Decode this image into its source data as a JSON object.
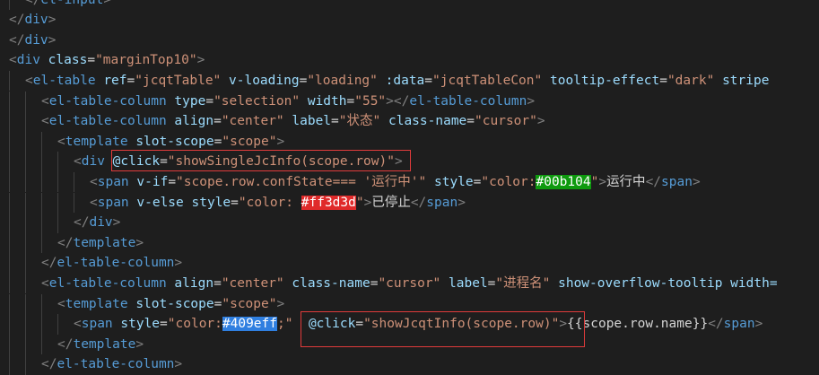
{
  "editor": {
    "colors": {
      "background": "#1e1e1e",
      "tag": "#569cd6",
      "attribute": "#9cdcfe",
      "string": "#ce9178",
      "punctuation": "#808080",
      "text": "#d4d4d4",
      "annotation_box": "#e03b3b"
    },
    "lines": [
      {
        "tokens": [
          {
            "c": "punct",
            "v": "</"
          },
          {
            "c": "tag",
            "v": "el-input"
          },
          {
            "c": "punct",
            "v": ">"
          }
        ]
      },
      {
        "tokens": [
          {
            "c": "punct",
            "v": "</"
          },
          {
            "c": "tag",
            "v": "div"
          },
          {
            "c": "punct",
            "v": ">"
          }
        ]
      },
      {
        "tokens": [
          {
            "c": "punct",
            "v": "</"
          },
          {
            "c": "tag",
            "v": "div"
          },
          {
            "c": "punct",
            "v": ">"
          }
        ]
      },
      {
        "tokens": [
          {
            "c": "punct",
            "v": "<"
          },
          {
            "c": "tag",
            "v": "div"
          },
          {
            "c": "text",
            "v": " "
          },
          {
            "c": "attr",
            "v": "class"
          },
          {
            "c": "op",
            "v": "="
          },
          {
            "c": "str",
            "v": "\"marginTop10\""
          },
          {
            "c": "punct",
            "v": ">"
          }
        ]
      },
      {
        "tokens": [
          {
            "c": "punct",
            "v": "<"
          },
          {
            "c": "tag",
            "v": "el-table"
          },
          {
            "c": "text",
            "v": " "
          },
          {
            "c": "attr",
            "v": "ref"
          },
          {
            "c": "op",
            "v": "="
          },
          {
            "c": "str",
            "v": "\"jcqtTable\""
          },
          {
            "c": "text",
            "v": " "
          },
          {
            "c": "attr",
            "v": "v-loading"
          },
          {
            "c": "op",
            "v": "="
          },
          {
            "c": "str",
            "v": "\"loading\""
          },
          {
            "c": "text",
            "v": " "
          },
          {
            "c": "attr",
            "v": ":data"
          },
          {
            "c": "op",
            "v": "="
          },
          {
            "c": "str",
            "v": "\"jcqtTableCon\""
          },
          {
            "c": "text",
            "v": " "
          },
          {
            "c": "attr",
            "v": "tooltip-effect"
          },
          {
            "c": "op",
            "v": "="
          },
          {
            "c": "str",
            "v": "\"dark\""
          },
          {
            "c": "text",
            "v": " "
          },
          {
            "c": "attr",
            "v": "stripe"
          }
        ]
      },
      {
        "tokens": [
          {
            "c": "punct",
            "v": "<"
          },
          {
            "c": "tag",
            "v": "el-table-column"
          },
          {
            "c": "text",
            "v": " "
          },
          {
            "c": "attr",
            "v": "type"
          },
          {
            "c": "op",
            "v": "="
          },
          {
            "c": "str",
            "v": "\"selection\""
          },
          {
            "c": "text",
            "v": " "
          },
          {
            "c": "attr",
            "v": "width"
          },
          {
            "c": "op",
            "v": "="
          },
          {
            "c": "str",
            "v": "\"55\""
          },
          {
            "c": "punct",
            "v": "></"
          },
          {
            "c": "tag",
            "v": "el-table-column"
          },
          {
            "c": "punct",
            "v": ">"
          }
        ]
      },
      {
        "tokens": [
          {
            "c": "punct",
            "v": "<"
          },
          {
            "c": "tag",
            "v": "el-table-column"
          },
          {
            "c": "text",
            "v": " "
          },
          {
            "c": "attr",
            "v": "align"
          },
          {
            "c": "op",
            "v": "="
          },
          {
            "c": "str",
            "v": "\"center\""
          },
          {
            "c": "text",
            "v": " "
          },
          {
            "c": "attr",
            "v": "label"
          },
          {
            "c": "op",
            "v": "="
          },
          {
            "c": "str",
            "v": "\"状态\""
          },
          {
            "c": "text",
            "v": " "
          },
          {
            "c": "attr",
            "v": "class-name"
          },
          {
            "c": "op",
            "v": "="
          },
          {
            "c": "str",
            "v": "\"cursor\""
          },
          {
            "c": "punct",
            "v": ">"
          }
        ]
      },
      {
        "tokens": [
          {
            "c": "punct",
            "v": "<"
          },
          {
            "c": "tag",
            "v": "template"
          },
          {
            "c": "text",
            "v": " "
          },
          {
            "c": "attr",
            "v": "slot-scope"
          },
          {
            "c": "op",
            "v": "="
          },
          {
            "c": "str",
            "v": "\"scope\""
          },
          {
            "c": "punct",
            "v": ">"
          }
        ]
      },
      {
        "tokens": [
          {
            "c": "punct",
            "v": "<"
          },
          {
            "c": "tag",
            "v": "div"
          },
          {
            "c": "text",
            "v": " "
          },
          {
            "c": "attr",
            "v": "@click"
          },
          {
            "c": "op",
            "v": "="
          },
          {
            "c": "str",
            "v": "\"showSingleJcInfo(scope.row)\""
          },
          {
            "c": "punct",
            "v": ">"
          }
        ]
      },
      {
        "tokens": [
          {
            "c": "punct",
            "v": "<"
          },
          {
            "c": "tag",
            "v": "span"
          },
          {
            "c": "text",
            "v": " "
          },
          {
            "c": "attr",
            "v": "v-if"
          },
          {
            "c": "op",
            "v": "="
          },
          {
            "c": "str",
            "v": "\"scope.row.confState=== '运行中'\""
          },
          {
            "c": "text",
            "v": " "
          },
          {
            "c": "attr",
            "v": "style"
          },
          {
            "c": "op",
            "v": "="
          },
          {
            "c": "str",
            "v": "\"color:"
          },
          {
            "c": "hl",
            "v": "#00b104",
            "bg": "#0e9a0e"
          },
          {
            "c": "str",
            "v": "\""
          },
          {
            "c": "punct",
            "v": ">"
          },
          {
            "c": "text",
            "v": "运行中"
          },
          {
            "c": "punct",
            "v": "</"
          },
          {
            "c": "tag",
            "v": "span"
          },
          {
            "c": "punct",
            "v": ">"
          }
        ]
      },
      {
        "tokens": [
          {
            "c": "punct",
            "v": "<"
          },
          {
            "c": "tag",
            "v": "span"
          },
          {
            "c": "text",
            "v": " "
          },
          {
            "c": "attr",
            "v": "v-else"
          },
          {
            "c": "text",
            "v": " "
          },
          {
            "c": "attr",
            "v": "style"
          },
          {
            "c": "op",
            "v": "="
          },
          {
            "c": "str",
            "v": "\"color: "
          },
          {
            "c": "hl",
            "v": "#ff3d3d",
            "bg": "#e02a2a"
          },
          {
            "c": "str",
            "v": "\""
          },
          {
            "c": "punct",
            "v": ">"
          },
          {
            "c": "text",
            "v": "已停止"
          },
          {
            "c": "punct",
            "v": "</"
          },
          {
            "c": "tag",
            "v": "span"
          },
          {
            "c": "punct",
            "v": ">"
          }
        ]
      },
      {
        "tokens": [
          {
            "c": "punct",
            "v": "</"
          },
          {
            "c": "tag",
            "v": "div"
          },
          {
            "c": "punct",
            "v": ">"
          }
        ]
      },
      {
        "tokens": [
          {
            "c": "punct",
            "v": "</"
          },
          {
            "c": "tag",
            "v": "template"
          },
          {
            "c": "punct",
            "v": ">"
          }
        ]
      },
      {
        "tokens": [
          {
            "c": "punct",
            "v": "</"
          },
          {
            "c": "tag",
            "v": "el-table-column"
          },
          {
            "c": "punct",
            "v": ">"
          }
        ]
      },
      {
        "tokens": [
          {
            "c": "punct",
            "v": "<"
          },
          {
            "c": "tag",
            "v": "el-table-column"
          },
          {
            "c": "text",
            "v": " "
          },
          {
            "c": "attr",
            "v": "align"
          },
          {
            "c": "op",
            "v": "="
          },
          {
            "c": "str",
            "v": "\"center\""
          },
          {
            "c": "text",
            "v": " "
          },
          {
            "c": "attr",
            "v": "class-name"
          },
          {
            "c": "op",
            "v": "="
          },
          {
            "c": "str",
            "v": "\"cursor\""
          },
          {
            "c": "text",
            "v": " "
          },
          {
            "c": "attr",
            "v": "label"
          },
          {
            "c": "op",
            "v": "="
          },
          {
            "c": "str",
            "v": "\"进程名\""
          },
          {
            "c": "text",
            "v": " "
          },
          {
            "c": "attr",
            "v": "show-overflow-tooltip"
          },
          {
            "c": "text",
            "v": " "
          },
          {
            "c": "attr",
            "v": "width="
          }
        ]
      },
      {
        "tokens": [
          {
            "c": "punct",
            "v": "<"
          },
          {
            "c": "tag",
            "v": "template"
          },
          {
            "c": "text",
            "v": " "
          },
          {
            "c": "attr",
            "v": "slot-scope"
          },
          {
            "c": "op",
            "v": "="
          },
          {
            "c": "str",
            "v": "\"scope\""
          },
          {
            "c": "punct",
            "v": ">"
          }
        ]
      },
      {
        "tokens": [
          {
            "c": "punct",
            "v": "<"
          },
          {
            "c": "tag",
            "v": "span"
          },
          {
            "c": "text",
            "v": " "
          },
          {
            "c": "attr",
            "v": "style"
          },
          {
            "c": "op",
            "v": "="
          },
          {
            "c": "str",
            "v": "\"color:"
          },
          {
            "c": "hl",
            "v": "#409eff",
            "bg": "#2f7fe0"
          },
          {
            "c": "str",
            "v": ";\""
          },
          {
            "c": "text",
            "v": "  "
          },
          {
            "c": "attr",
            "v": "@click"
          },
          {
            "c": "op",
            "v": "="
          },
          {
            "c": "str",
            "v": "\"showJcqtInfo(scope.row)\""
          },
          {
            "c": "punct",
            "v": ">"
          },
          {
            "c": "text",
            "v": "{{scope.row.name}}"
          },
          {
            "c": "punct",
            "v": "</"
          },
          {
            "c": "tag",
            "v": "span"
          },
          {
            "c": "punct",
            "v": ">"
          }
        ]
      },
      {
        "tokens": [
          {
            "c": "punct",
            "v": "</"
          },
          {
            "c": "tag",
            "v": "template"
          },
          {
            "c": "punct",
            "v": ">"
          }
        ]
      },
      {
        "tokens": [
          {
            "c": "punct",
            "v": "</"
          },
          {
            "c": "tag",
            "v": "el-table-column"
          },
          {
            "c": "punct",
            "v": ">"
          }
        ]
      }
    ]
  }
}
